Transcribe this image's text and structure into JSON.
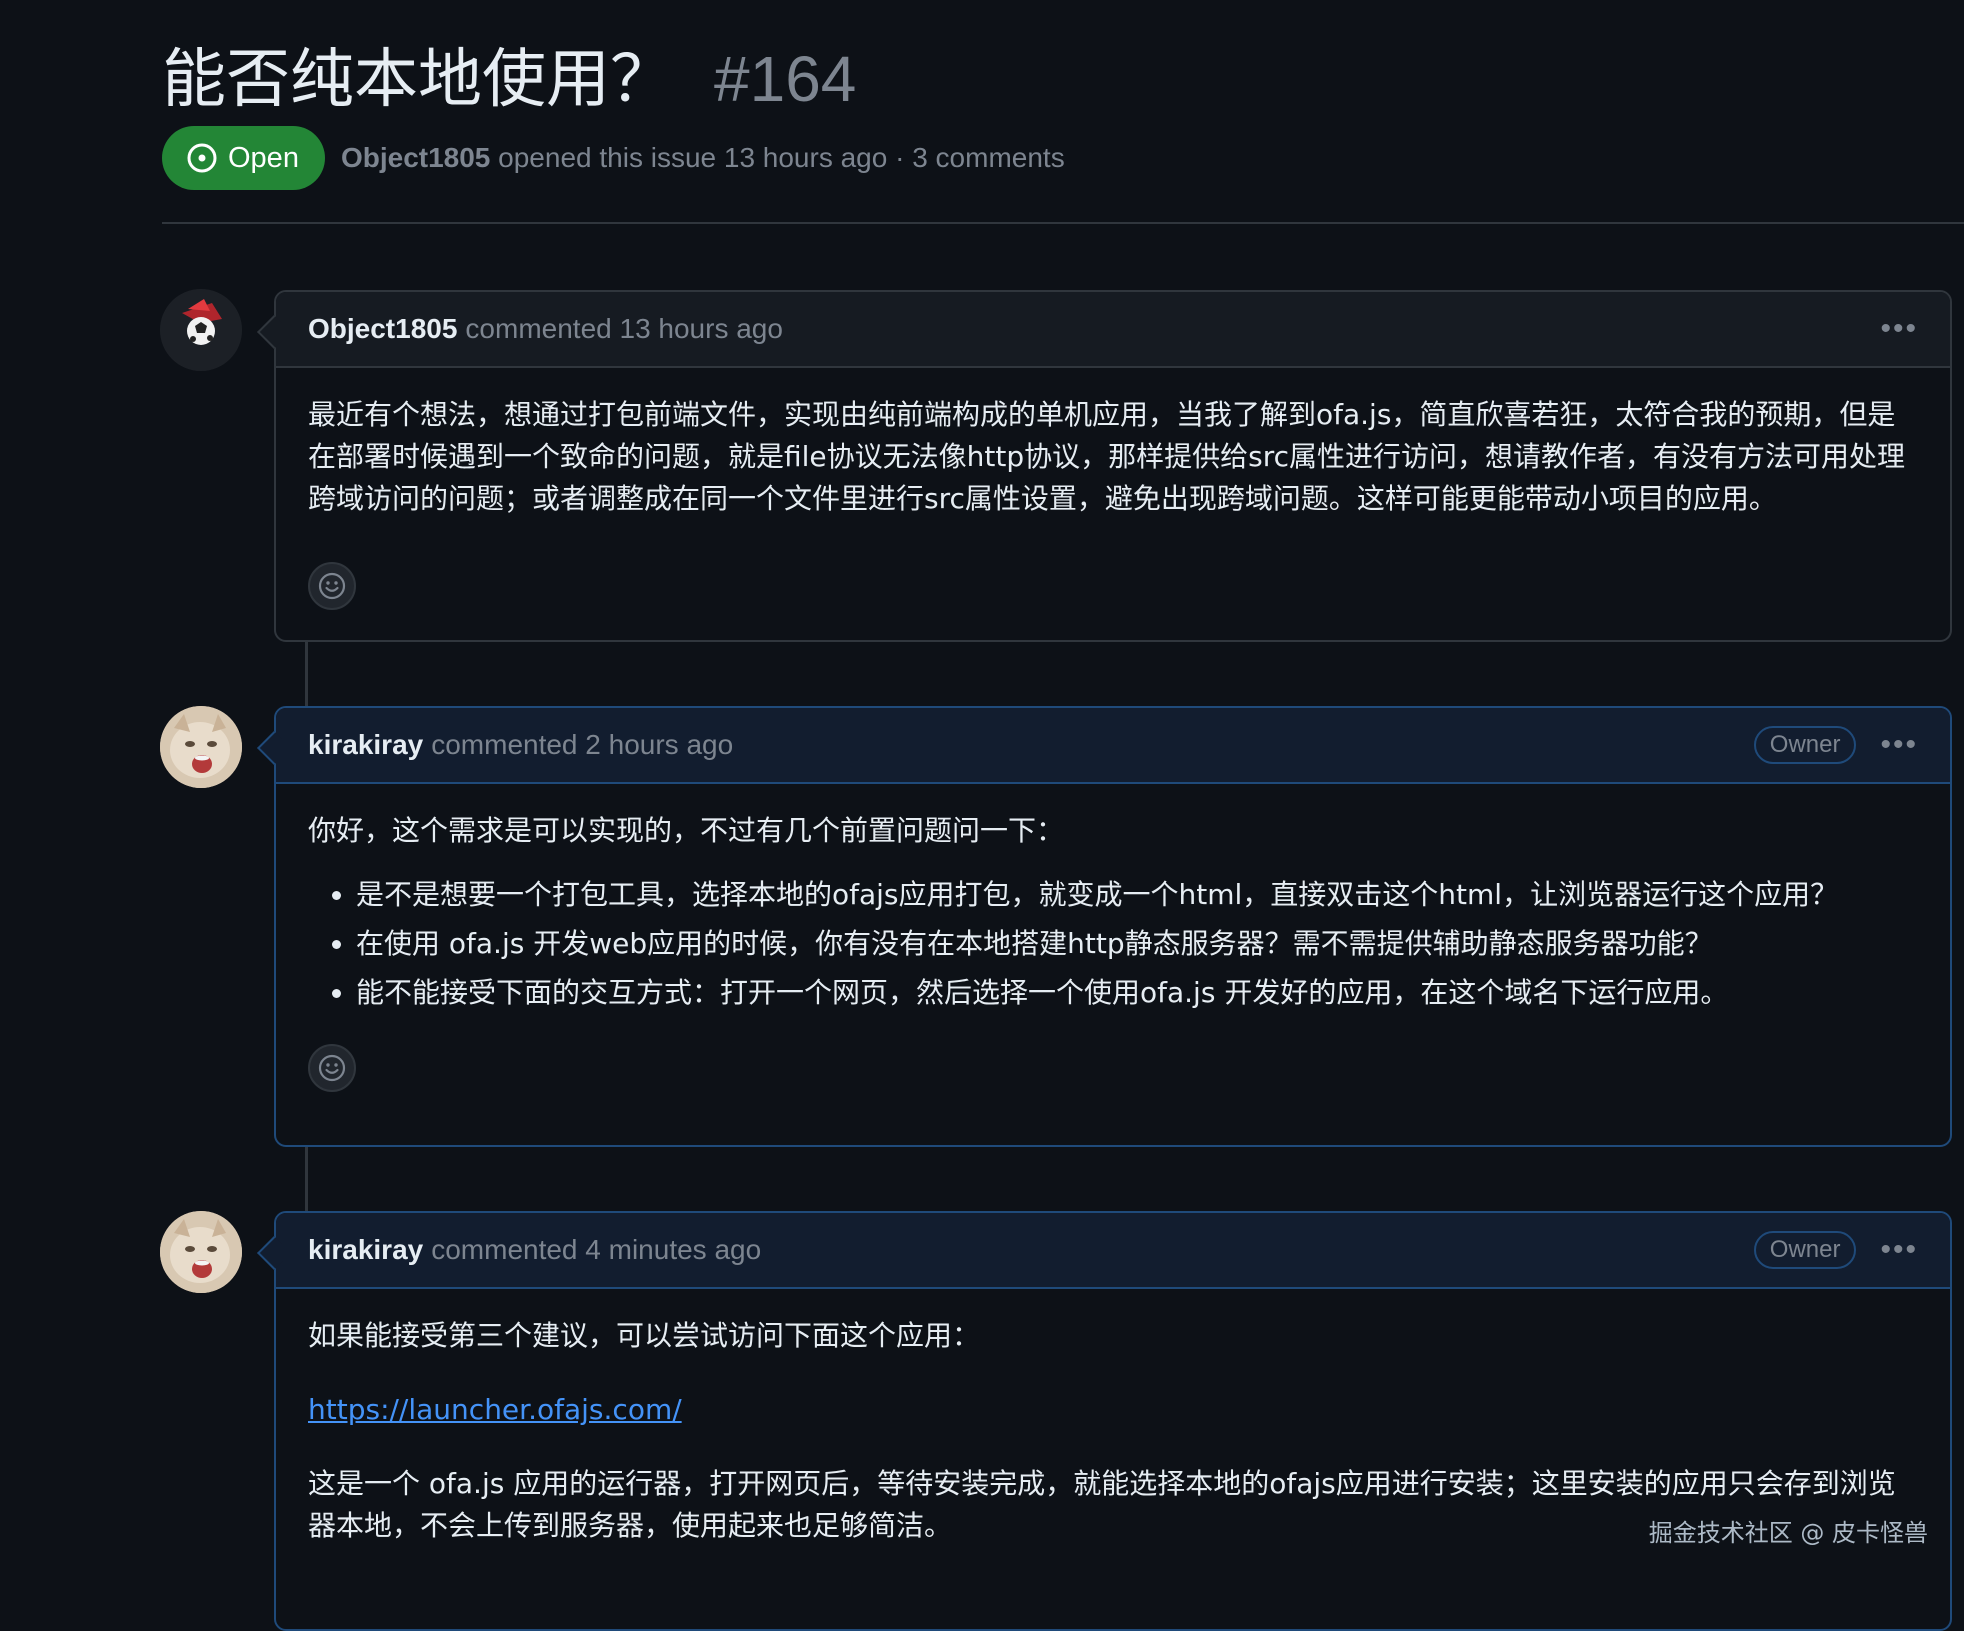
{
  "issue": {
    "title": "能否纯本地使用？",
    "number": "#164",
    "state": "Open",
    "author": "Object1805",
    "meta_suffix": "opened this issue 13 hours ago · 3 comments"
  },
  "comments": [
    {
      "author": "Object1805",
      "action": "commented 13 hours ago",
      "body": "最近有个想法，想通过打包前端文件，实现由纯前端构成的单机应用，当我了解到ofa.js，简直欣喜若狂，太符合我的预期，但是在部署时候遇到一个致命的问题，就是file协议无法像http协议，那样提供给src属性进行访问，想请教作者，有没有方法可用处理跨域访问的问题；或者调整成在同一个文件里进行src属性设置，避免出现跨域问题。这样可能更能带动小项目的应用。"
    },
    {
      "author": "kirakiray",
      "action": "commented 2 hours ago",
      "badge": "Owner",
      "intro": "你好，这个需求是可以实现的，不过有几个前置问题问一下：",
      "bullets": [
        "是不是想要一个打包工具，选择本地的ofajs应用打包，就变成一个html，直接双击这个html，让浏览器运行这个应用？",
        "在使用 ofa.js 开发web应用的时候，你有没有在本地搭建http静态服务器？需不需提供辅助静态服务器功能？",
        "能不能接受下面的交互方式：打开一个网页，然后选择一个使用ofa.js 开发好的应用，在这个域名下运行应用。"
      ]
    },
    {
      "author": "kirakiray",
      "action": "commented 4 minutes ago",
      "badge": "Owner",
      "intro": "如果能接受第三个建议，可以尝试访问下面这个应用：",
      "link": "https://launcher.ofajs.com/",
      "body": "这是一个 ofa.js 应用的运行器，打开网页后，等待安装完成，就能选择本地的ofajs应用进行安装；这里安装的应用只会存到浏览器本地，不会上传到服务器，使用起来也足够简洁。"
    }
  ],
  "watermark": "掘金技术社区 @ 皮卡怪兽",
  "colors": {
    "background": "#0d1117",
    "open_badge": "#238636",
    "owner_border": "#1f4a7a",
    "link": "#4493f8",
    "muted_text": "#7d8590"
  }
}
